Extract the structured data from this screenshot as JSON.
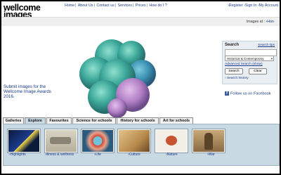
{
  "logo": {
    "line1": "wellcome",
    "line2": "images"
  },
  "topnav": [
    "Home",
    "About Us",
    "Contact us",
    "Services",
    "Prices",
    "How do I ?"
  ],
  "account": {
    "register": "Register",
    "signin": "Sign In",
    "myaccount": "My Account"
  },
  "images_at": {
    "label": "Images at :",
    "link": "Hon"
  },
  "promo_text": "Submit images for the Wellcome Image Awards 2016.",
  "search": {
    "title": "Search",
    "tips": "Search tips",
    "input_value": "",
    "collection_value": "Historical & Contemporary",
    "advanced": "Advanced Search (show)",
    "search_button": "Search",
    "clear_button": "Clear",
    "history": "Search history"
  },
  "facebook": "Follow us on Facebook",
  "tabs": [
    "Galleries",
    "Explore",
    "Favourites",
    "Science for schools",
    "History for schools",
    "Art for schools"
  ],
  "active_tab": "Explore",
  "thumbs": [
    "Highlights",
    "Illness & wellness",
    "Life",
    "Culture",
    "Nature",
    "War"
  ],
  "colors": {
    "link": "#1a3a8a",
    "panel": "#c9d9e4",
    "cell": "#4fb6a8",
    "cell_pink": "#c79ad3"
  }
}
